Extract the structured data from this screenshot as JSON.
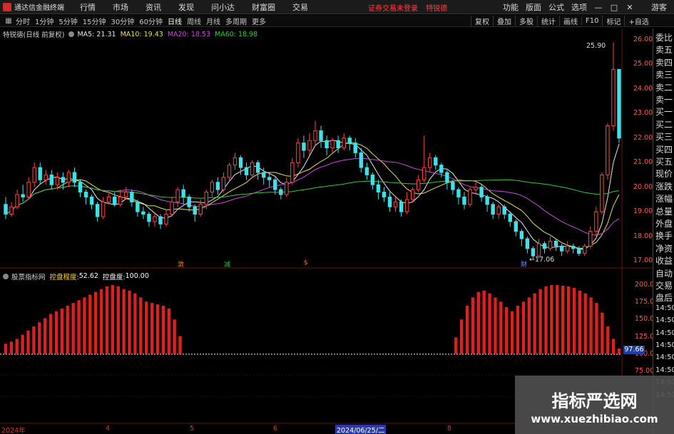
{
  "app": {
    "title": "通达信金融终端",
    "icon": "tdx-logo-icon"
  },
  "menu": {
    "items": [
      "行情",
      "市场",
      "资讯",
      "发现",
      "问小达",
      "财富圈",
      "交易"
    ],
    "notice": "证券交易未登录",
    "stock_link": "特锐德",
    "right_items": [
      "功能",
      "版面",
      "公式",
      "选项"
    ],
    "guest": "游客"
  },
  "toolbar": {
    "periods": [
      "分时",
      "1分钟",
      "5分钟",
      "15分钟",
      "30分钟",
      "60分钟",
      "日线",
      "周线",
      "月线",
      "多周期",
      "更多"
    ],
    "active_period": "日线",
    "right_items": [
      "复权",
      "叠加",
      "多股",
      "统计",
      "画线",
      "F10",
      "标记",
      "+自选"
    ]
  },
  "stock_info": {
    "name": "特锐德(日线 前复权)",
    "ma": [
      {
        "label": "MA5: 21.31",
        "color": "#e8e8e8"
      },
      {
        "label": "MA10: 19.43",
        "color": "#e8e05a"
      },
      {
        "label": "MA20: 18.53",
        "color": "#c84bd8"
      },
      {
        "label": "MA60: 18.98",
        "color": "#36c936"
      }
    ]
  },
  "price_axis": [
    "26.00",
    "25.00",
    "24.00",
    "23.00",
    "22.00",
    "21.00",
    "20.00",
    "19.00",
    "18.00",
    "17.00"
  ],
  "price_markers": {
    "high": "25.90",
    "low": "17.06"
  },
  "event_marks": [
    {
      "text": "激",
      "color": "#ff6a3a"
    },
    {
      "text": "减",
      "color": "#36c936"
    },
    {
      "text": "$",
      "color": "#ff6a3a"
    },
    {
      "text": "财",
      "color": "#6a9cff"
    }
  ],
  "indicator": {
    "name": "股票指标网",
    "label1": "控盘程度:",
    "value1": "52.62",
    "label2": "控盘度:",
    "value2": "100.00",
    "axis": [
      "200.00",
      "175.00",
      "150.00",
      "125.00",
      "100.00",
      "75.00"
    ],
    "current_value": "97.66"
  },
  "dates": {
    "labels": [
      "2024年",
      "4",
      "5",
      "6",
      "8"
    ],
    "highlight": "2024/06/25/二"
  },
  "right_panel": [
    "委比",
    "卖五",
    "卖四",
    "卖三",
    "卖二",
    "卖一",
    "买一",
    "买二",
    "买三",
    "买四",
    "买五",
    "现价",
    "涨跌",
    "涨幅",
    "总量",
    "外盘",
    "换手",
    "净资",
    "收益",
    "自动",
    "交易",
    "盘后",
    "14:50",
    "14:50",
    "14:50",
    "14:50",
    "14:50",
    "14:50",
    "14:50",
    "14:50"
  ],
  "watermark": {
    "title": "指标严选网",
    "url": "www.xuezhibiao.com"
  },
  "colors": {
    "up": "#ff4545",
    "down": "#40e0e8",
    "ma5": "#e8e8e8",
    "ma10": "#e8e05a",
    "ma20": "#c84bd8",
    "ma60": "#36c936"
  },
  "chart_data": {
    "type": "candlestick",
    "dates": [
      "2024年",
      "4",
      "5",
      "6",
      "8"
    ],
    "candles": [
      [
        19.3,
        18.9,
        19.6,
        18.7
      ],
      [
        18.9,
        19.2,
        19.4,
        18.8
      ],
      [
        19.2,
        19.7,
        19.9,
        19.1
      ],
      [
        19.7,
        19.6,
        20.1,
        19.4
      ],
      [
        19.6,
        20.2,
        20.4,
        19.5
      ],
      [
        20.2,
        20.8,
        21.0,
        20.0
      ],
      [
        20.8,
        20.3,
        21.0,
        20.1
      ],
      [
        20.3,
        20.5,
        20.7,
        20.1
      ],
      [
        20.5,
        20.1,
        20.7,
        19.9
      ],
      [
        20.1,
        20.4,
        20.6,
        19.9
      ],
      [
        20.4,
        20.2,
        20.6,
        19.9
      ],
      [
        20.2,
        20.6,
        20.7,
        20.0
      ],
      [
        20.6,
        20.2,
        20.8,
        20.0
      ],
      [
        20.2,
        19.8,
        20.3,
        19.6
      ],
      [
        19.8,
        19.6,
        19.9,
        19.3
      ],
      [
        19.6,
        19.3,
        19.7,
        19.1
      ],
      [
        19.3,
        18.8,
        19.4,
        18.6
      ],
      [
        18.8,
        19.4,
        19.6,
        18.7
      ],
      [
        19.4,
        19.6,
        19.8,
        19.3
      ],
      [
        19.6,
        19.3,
        19.8,
        19.2
      ],
      [
        19.3,
        19.6,
        19.9,
        19.2
      ],
      [
        19.6,
        19.8,
        20.0,
        19.5
      ],
      [
        19.8,
        19.4,
        19.9,
        19.2
      ],
      [
        19.4,
        19.0,
        19.5,
        18.8
      ],
      [
        19.0,
        18.9,
        19.2,
        18.7
      ],
      [
        18.9,
        18.6,
        19.0,
        18.4
      ],
      [
        18.6,
        18.8,
        19.0,
        18.4
      ],
      [
        18.8,
        18.5,
        18.9,
        18.3
      ],
      [
        18.5,
        18.9,
        19.1,
        18.4
      ],
      [
        18.9,
        19.4,
        19.6,
        18.8
      ],
      [
        19.4,
        19.9,
        20.0,
        19.2
      ],
      [
        19.9,
        19.6,
        20.1,
        19.3
      ],
      [
        19.6,
        19.2,
        19.7,
        19.0
      ],
      [
        19.2,
        18.9,
        19.3,
        18.6
      ],
      [
        18.9,
        19.3,
        19.5,
        18.8
      ],
      [
        19.3,
        19.8,
        19.9,
        19.1
      ],
      [
        19.8,
        20.2,
        20.3,
        19.6
      ],
      [
        20.2,
        19.9,
        20.4,
        19.7
      ],
      [
        19.9,
        20.4,
        20.6,
        19.8
      ],
      [
        20.4,
        20.9,
        21.0,
        20.2
      ],
      [
        20.9,
        21.2,
        21.4,
        20.7
      ],
      [
        21.2,
        20.8,
        21.3,
        20.5
      ],
      [
        20.8,
        20.5,
        21.0,
        20.3
      ],
      [
        20.5,
        21.0,
        21.1,
        20.4
      ],
      [
        21.0,
        20.6,
        21.1,
        20.3
      ],
      [
        20.6,
        20.4,
        20.8,
        20.1
      ],
      [
        20.4,
        20.3,
        20.6,
        20.0
      ],
      [
        20.3,
        19.9,
        20.4,
        19.7
      ],
      [
        19.9,
        19.7,
        20.0,
        19.5
      ],
      [
        19.7,
        20.2,
        20.4,
        19.6
      ],
      [
        20.2,
        21.0,
        21.2,
        20.1
      ],
      [
        21.0,
        21.8,
        22.0,
        20.8
      ],
      [
        21.8,
        21.5,
        22.1,
        21.2
      ],
      [
        21.5,
        21.9,
        22.2,
        21.3
      ],
      [
        21.9,
        22.3,
        22.7,
        21.7
      ],
      [
        22.3,
        21.9,
        22.5,
        21.6
      ],
      [
        21.9,
        21.6,
        22.1,
        21.3
      ],
      [
        21.6,
        21.9,
        22.0,
        21.4
      ],
      [
        21.9,
        21.6,
        22.1,
        21.4
      ],
      [
        21.6,
        22.0,
        22.2,
        21.5
      ],
      [
        22.0,
        21.8,
        22.1,
        21.5
      ],
      [
        21.8,
        21.4,
        22.0,
        21.2
      ],
      [
        21.4,
        20.8,
        21.6,
        20.6
      ],
      [
        20.8,
        20.5,
        21.0,
        20.3
      ],
      [
        20.5,
        20.1,
        20.6,
        19.9
      ],
      [
        20.1,
        19.8,
        20.3,
        19.5
      ],
      [
        19.8,
        19.6,
        20.0,
        19.4
      ],
      [
        19.6,
        19.2,
        19.8,
        19.0
      ],
      [
        19.2,
        19.4,
        19.6,
        19.0
      ],
      [
        19.4,
        19.0,
        19.5,
        18.8
      ],
      [
        19.0,
        19.5,
        19.8,
        18.9
      ],
      [
        19.5,
        19.9,
        20.0,
        19.4
      ],
      [
        19.9,
        20.3,
        20.5,
        19.8
      ],
      [
        20.3,
        20.8,
        22.1,
        20.2
      ],
      [
        20.8,
        21.2,
        21.4,
        20.6
      ],
      [
        21.2,
        20.9,
        21.3,
        20.7
      ],
      [
        20.9,
        20.6,
        21.0,
        20.4
      ],
      [
        20.6,
        20.2,
        20.7,
        19.9
      ],
      [
        20.2,
        19.9,
        20.3,
        19.7
      ],
      [
        19.9,
        19.6,
        20.0,
        19.3
      ],
      [
        19.6,
        19.3,
        19.8,
        19.1
      ],
      [
        19.3,
        19.9,
        20.0,
        19.2
      ],
      [
        19.9,
        20.0,
        20.2,
        19.7
      ],
      [
        20.0,
        19.6,
        20.1,
        19.4
      ],
      [
        19.6,
        19.3,
        19.7,
        19.0
      ],
      [
        19.3,
        18.9,
        19.4,
        18.7
      ],
      [
        18.9,
        19.2,
        19.3,
        18.7
      ],
      [
        19.2,
        18.9,
        19.3,
        18.7
      ],
      [
        18.9,
        18.6,
        19.0,
        18.4
      ],
      [
        18.6,
        18.2,
        18.7,
        18.0
      ],
      [
        18.2,
        17.9,
        18.3,
        17.6
      ],
      [
        17.9,
        17.5,
        18.0,
        17.3
      ],
      [
        17.5,
        17.2,
        17.6,
        17.06
      ],
      [
        17.2,
        17.7,
        17.9,
        17.1
      ],
      [
        17.7,
        17.5,
        17.8,
        17.3
      ],
      [
        17.5,
        17.8,
        18.0,
        17.4
      ],
      [
        17.8,
        17.6,
        17.9,
        17.4
      ],
      [
        17.6,
        17.4,
        17.7,
        17.2
      ],
      [
        17.4,
        17.6,
        17.8,
        17.3
      ],
      [
        17.6,
        17.5,
        17.7,
        17.3
      ],
      [
        17.5,
        17.3,
        17.6,
        17.2
      ],
      [
        17.3,
        17.6,
        17.7,
        17.2
      ],
      [
        17.6,
        18.2,
        18.4,
        17.5
      ],
      [
        18.2,
        19.0,
        19.2,
        18.0
      ],
      [
        19.0,
        20.5,
        20.6,
        18.9
      ],
      [
        20.5,
        22.5,
        22.6,
        20.3
      ],
      [
        22.5,
        24.8,
        25.9,
        22.3
      ],
      [
        24.8,
        22.0,
        24.2,
        21.8
      ]
    ],
    "indicator_values": [
      115,
      118,
      122,
      128,
      134,
      140,
      146,
      152,
      158,
      162,
      166,
      170,
      174,
      178,
      182,
      186,
      190,
      194,
      198,
      200,
      198,
      194,
      192,
      188,
      182,
      176,
      174,
      172,
      170,
      166,
      150,
      126,
      100,
      100,
      100,
      100,
      100,
      100,
      100,
      100,
      100,
      100,
      100,
      100,
      100,
      100,
      100,
      100,
      100,
      100,
      100,
      100,
      100,
      100,
      100,
      100,
      100,
      100,
      100,
      100,
      100,
      100,
      100,
      100,
      100,
      100,
      100,
      100,
      100,
      100,
      100,
      100,
      100,
      100,
      100,
      100,
      100,
      100,
      100,
      100,
      124,
      150,
      170,
      182,
      190,
      192,
      188,
      182,
      176,
      168,
      162,
      170,
      176,
      182,
      188,
      194,
      198,
      200,
      200,
      199,
      198,
      196,
      192,
      188,
      182,
      174,
      160,
      140,
      122,
      108
    ],
    "ylim": [
      17.0,
      26.0
    ],
    "indicator_ylim": [
      75,
      200
    ]
  }
}
